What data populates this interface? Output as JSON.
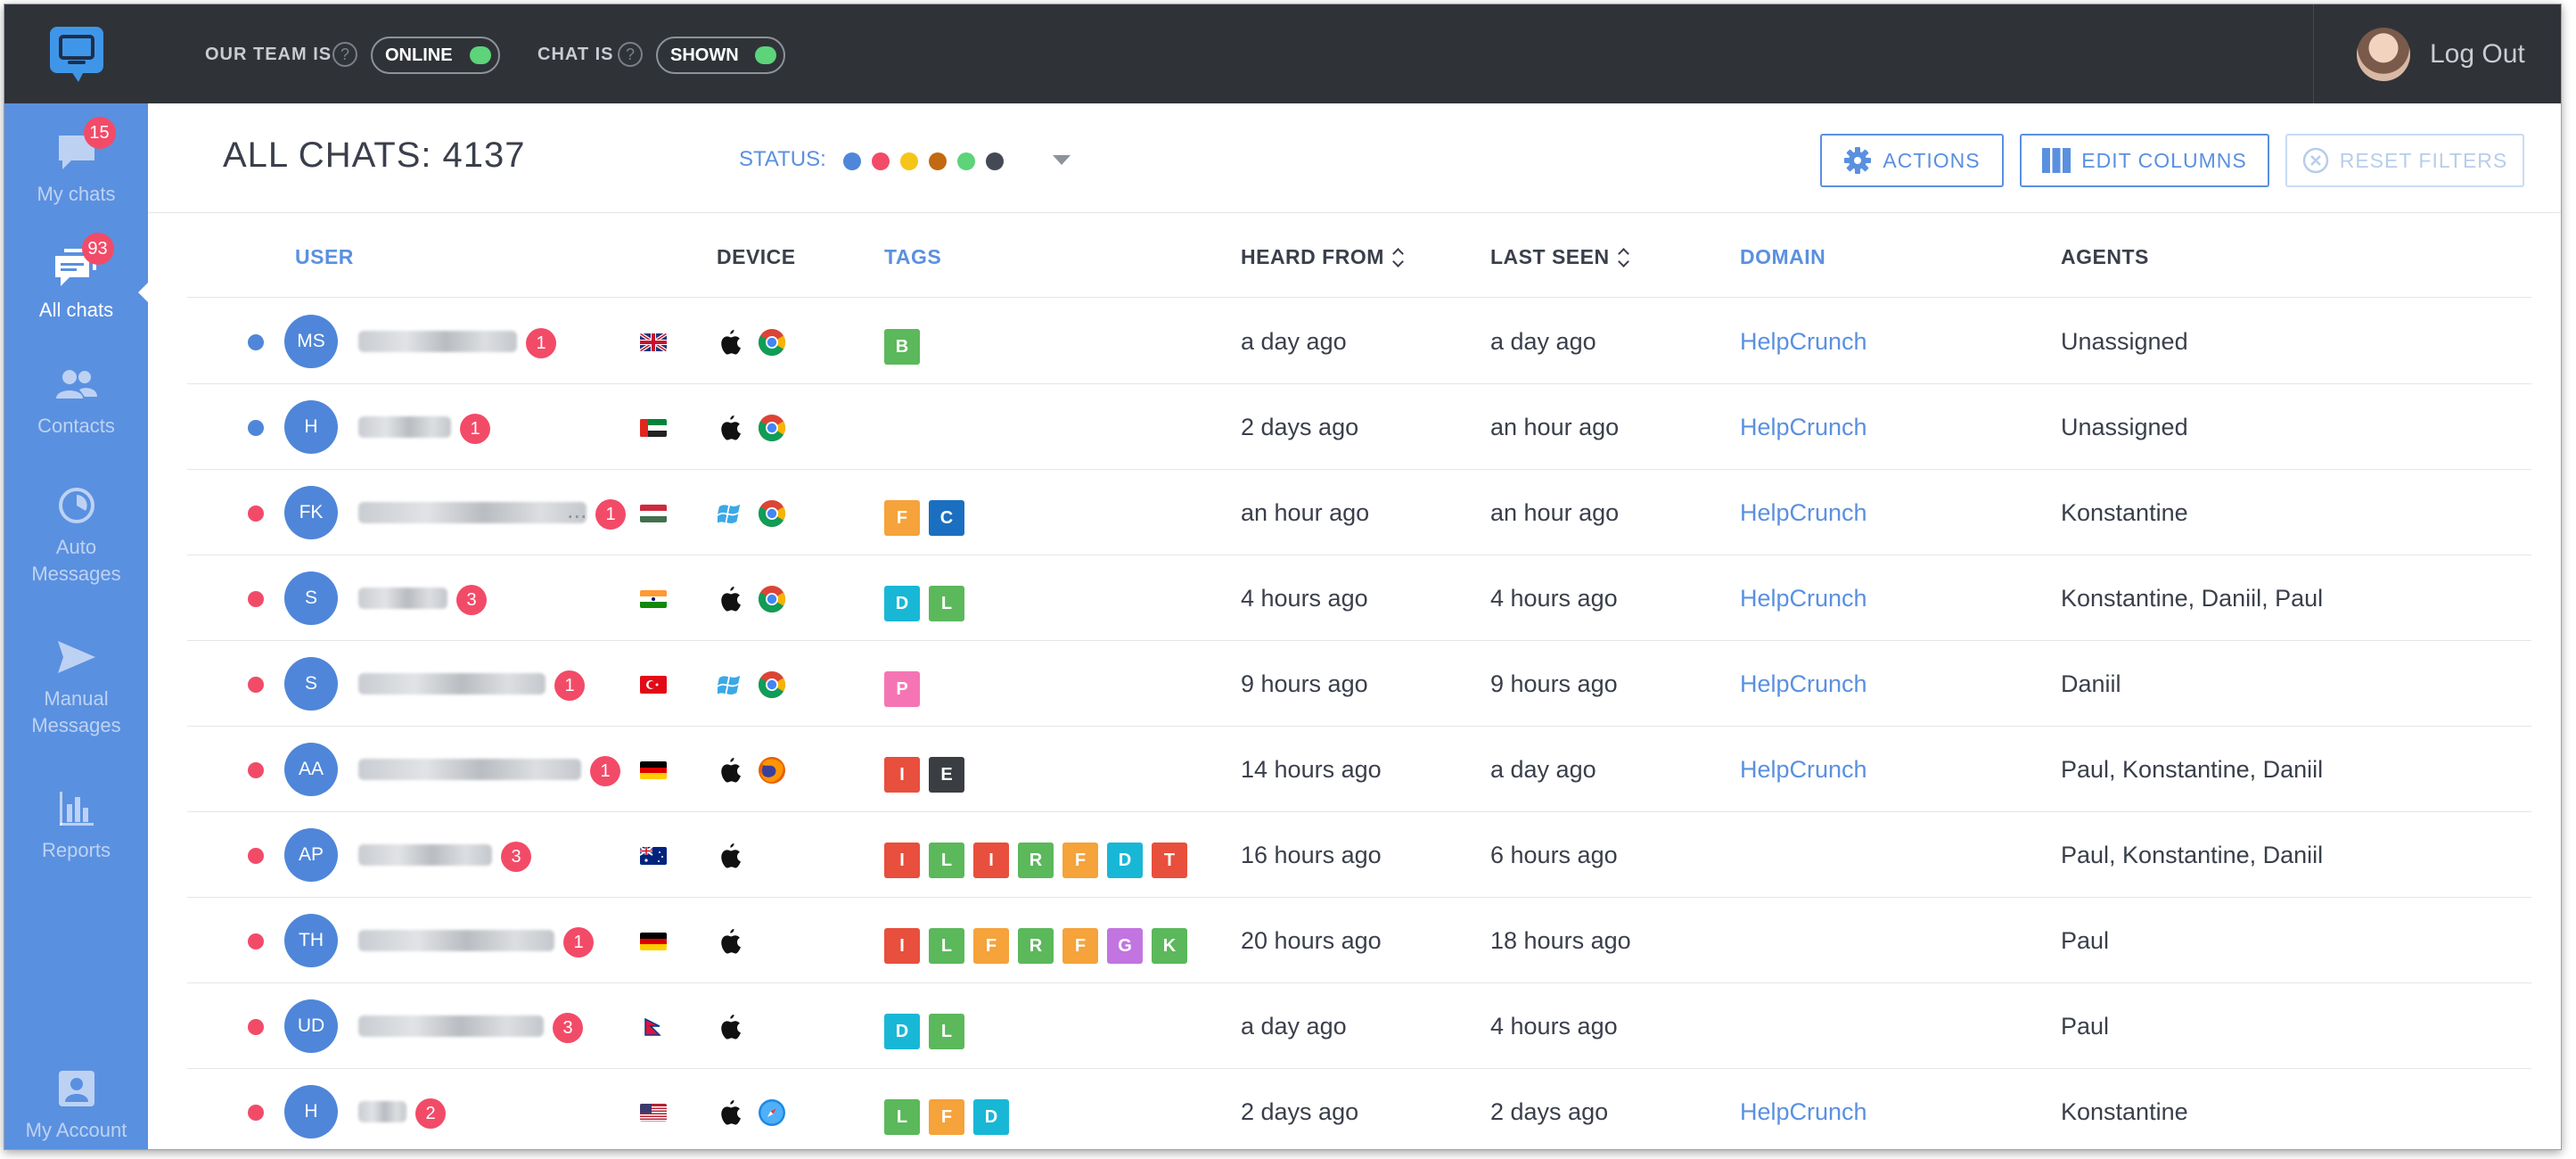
{
  "topbar": {
    "team_label": "OUR TEAM IS",
    "team_toggle": "ONLINE",
    "chat_label": "CHAT IS",
    "chat_toggle": "SHOWN",
    "help_glyph": "?",
    "logout": "Log Out"
  },
  "sidebar": {
    "items": [
      {
        "label": "My chats",
        "badge": "15",
        "icon": "chat-bubble-icon"
      },
      {
        "label": "All chats",
        "badge": "93",
        "icon": "chat-bubbles-icon",
        "active": true
      },
      {
        "label": "Contacts",
        "icon": "contacts-icon"
      },
      {
        "label": "Auto Messages",
        "icon": "auto-messages-icon"
      },
      {
        "label": "Manual Messages",
        "icon": "send-icon"
      },
      {
        "label": "Reports",
        "icon": "bar-chart-icon"
      },
      {
        "label": "My Account",
        "icon": "account-icon"
      }
    ]
  },
  "header": {
    "title": "ALL CHATS:",
    "count": "4137",
    "status_label": "STATUS:",
    "status_colors": [
      "#4f86d9",
      "#f24b68",
      "#f5c518",
      "#c26a12",
      "#5dd37a",
      "#444a55"
    ],
    "actions": "ACTIONS",
    "edit_columns": "EDIT COLUMNS",
    "reset_filters": "RESET FILTERS"
  },
  "columns": {
    "user": "USER",
    "device": "DEVICE",
    "tags": "TAGS",
    "heard_from": "HEARD FROM",
    "last_seen": "LAST SEEN",
    "domain": "DOMAIN",
    "agents": "AGENTS"
  },
  "colors": {
    "accent": "#5a90e0",
    "status_blue": "#4f86d9",
    "status_red": "#f24b68",
    "topbar": "#2f3338",
    "tag": {
      "B": "#5bb85b",
      "F": "#f5a33a",
      "C": "#1b6fc0",
      "D": "#19b7d6",
      "L": "#5bb85b",
      "P": "#f575b4",
      "I": "#e84f3c",
      "E": "#3a3d42",
      "R": "#5bb85b",
      "T": "#e84f3c",
      "G": "#c275e0",
      "K": "#5bb85b"
    }
  },
  "rows": [
    {
      "status": "blue",
      "initials": "MS",
      "unread": "1",
      "flag": "uk",
      "os": "apple-icon",
      "browser": "chrome-icon",
      "tags": [
        "B"
      ],
      "heard_from": "a day ago",
      "last_seen": "a day ago",
      "domain": "HelpCrunch",
      "agents": "Unassigned"
    },
    {
      "status": "blue",
      "initials": "H",
      "unread": "1",
      "flag": "ae",
      "os": "apple-icon",
      "browser": "chrome-icon",
      "tags": [],
      "heard_from": "2 days ago",
      "last_seen": "an hour ago",
      "domain": "HelpCrunch",
      "agents": "Unassigned"
    },
    {
      "status": "red",
      "initials": "FK",
      "unread": "1",
      "name_ellipsis": "...",
      "flag": "hu",
      "os": "windows-icon",
      "browser": "chrome-icon",
      "tags": [
        "F",
        "C"
      ],
      "heard_from": "an hour ago",
      "last_seen": "an hour ago",
      "domain": "HelpCrunch",
      "agents": "Konstantine"
    },
    {
      "status": "red",
      "initials": "S",
      "unread": "3",
      "flag": "in",
      "os": "apple-icon",
      "browser": "chrome-icon",
      "tags": [
        "D",
        "L"
      ],
      "heard_from": "4 hours ago",
      "last_seen": "4 hours ago",
      "domain": "HelpCrunch",
      "agents": "Konstantine, Daniil, Paul"
    },
    {
      "status": "red",
      "initials": "S",
      "unread": "1",
      "flag": "tr",
      "os": "windows-icon",
      "browser": "chrome-icon",
      "tags": [
        "P"
      ],
      "heard_from": "9 hours ago",
      "last_seen": "9 hours ago",
      "domain": "HelpCrunch",
      "agents": "Daniil"
    },
    {
      "status": "red",
      "initials": "AA",
      "unread": "1",
      "flag": "de",
      "os": "apple-icon",
      "browser": "firefox-icon",
      "tags": [
        "I",
        "E"
      ],
      "heard_from": "14 hours ago",
      "last_seen": "a day ago",
      "domain": "HelpCrunch",
      "agents": "Paul, Konstantine, Daniil"
    },
    {
      "status": "red",
      "initials": "AP",
      "unread": "3",
      "flag": "au",
      "os": "apple-icon",
      "browser": "",
      "tags": [
        "I",
        "L",
        "I",
        "R",
        "F",
        "D",
        "T"
      ],
      "heard_from": "16 hours ago",
      "last_seen": "6 hours ago",
      "domain": "",
      "agents": "Paul, Konstantine, Daniil"
    },
    {
      "status": "red",
      "initials": "TH",
      "unread": "1",
      "flag": "de",
      "os": "apple-icon",
      "browser": "",
      "tags": [
        "I",
        "L",
        "F",
        "R",
        "F",
        "G",
        "K"
      ],
      "heard_from": "20 hours ago",
      "last_seen": "18 hours ago",
      "domain": "",
      "agents": "Paul"
    },
    {
      "status": "red",
      "initials": "UD",
      "unread": "3",
      "flag": "np",
      "os": "apple-icon",
      "browser": "",
      "tags": [
        "D",
        "L"
      ],
      "heard_from": "a day ago",
      "last_seen": "4 hours ago",
      "domain": "",
      "agents": "Paul"
    },
    {
      "status": "red",
      "initials": "H",
      "unread": "2",
      "flag": "us",
      "os": "apple-icon",
      "browser": "safari-icon",
      "tags": [
        "L",
        "F",
        "D"
      ],
      "heard_from": "2 days ago",
      "last_seen": "2 days ago",
      "domain": "HelpCrunch",
      "agents": "Konstantine"
    }
  ]
}
